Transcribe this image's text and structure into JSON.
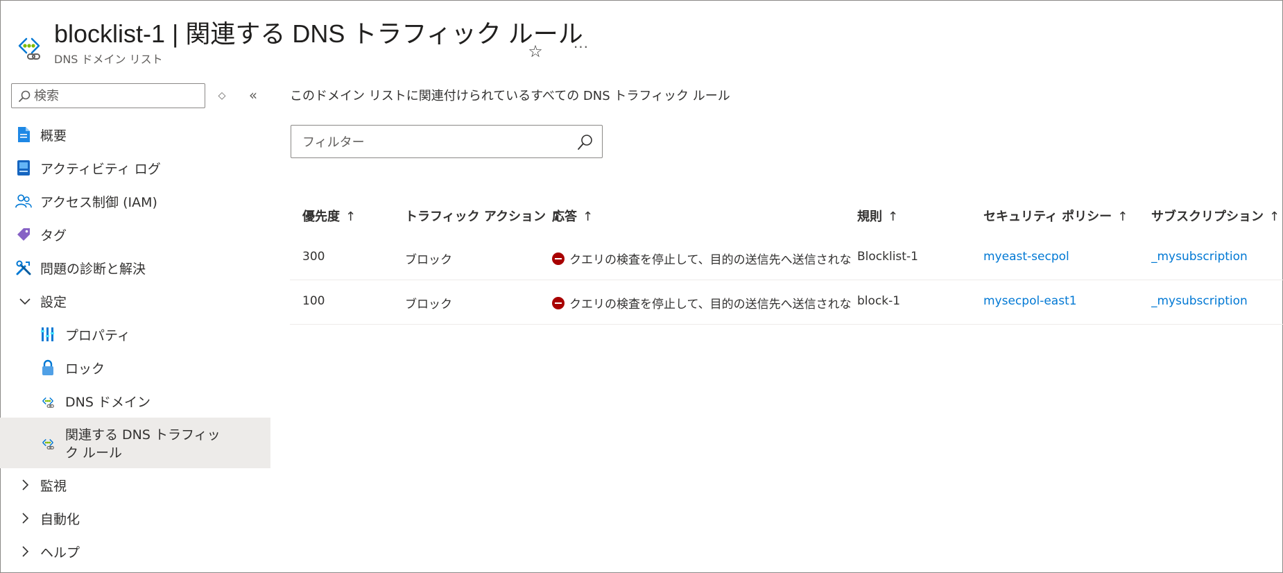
{
  "header": {
    "title": "blocklist-1 | 関連する DNS トラフィック ルール",
    "subtitle": "DNS ドメイン リスト",
    "favorite_glyph": "☆",
    "more_glyph": "···",
    "resource_icon": "dns-domain-list-icon"
  },
  "sidebar": {
    "search_placeholder": "検索",
    "updown_glyph": "◇",
    "collapse_glyph": "«",
    "items": [
      {
        "label": "概要",
        "icon": "overview-icon"
      },
      {
        "label": "アクティビティ ログ",
        "icon": "activity-log-icon"
      },
      {
        "label": "アクセス制御 (IAM)",
        "icon": "iam-icon"
      },
      {
        "label": "タグ",
        "icon": "tag-icon"
      },
      {
        "label": "問題の診断と解決",
        "icon": "diagnose-icon"
      },
      {
        "label": "設定",
        "icon": "chevron-down-icon",
        "expanded": true
      },
      {
        "label": "プロパティ",
        "icon": "properties-icon"
      },
      {
        "label": "ロック",
        "icon": "lock-icon"
      },
      {
        "label": "DNS ドメイン",
        "icon": "dns-domain-icon"
      },
      {
        "label": "関連する DNS トラフィック ルール",
        "icon": "dns-traffic-rule-icon",
        "selected": true
      },
      {
        "label": "監視",
        "icon": "chevron-right-icon"
      },
      {
        "label": "自動化",
        "icon": "chevron-right-icon"
      },
      {
        "label": "ヘルプ",
        "icon": "chevron-right-icon"
      }
    ]
  },
  "main": {
    "description": "このドメイン リストに関連付けられているすべての DNS トラフィック ルール",
    "filter_placeholder": "フィルター",
    "columns": [
      "優先度",
      "トラフィック アクション",
      "応答",
      "規則",
      "セキュリティ ポリシー",
      "サブスクリプション"
    ],
    "sort_glyph": "↑",
    "rows": [
      {
        "priority": "300",
        "action": "ブロック",
        "response": "クエリの検査を停止して、目的の送信先へ送信されない。",
        "rule": "Blocklist-1",
        "policy": "myeast-secpol",
        "subscription": "_mysubscription"
      },
      {
        "priority": "100",
        "action": "ブロック",
        "response": "クエリの検査を停止して、目的の送信先へ送信されない。",
        "rule": "block-1",
        "policy": "mysecpol-east1",
        "subscription": "_mysubscription"
      }
    ],
    "colors": {
      "link": "#0078d4",
      "stop": "#a80000",
      "selected_bg": "#edebe9"
    }
  }
}
